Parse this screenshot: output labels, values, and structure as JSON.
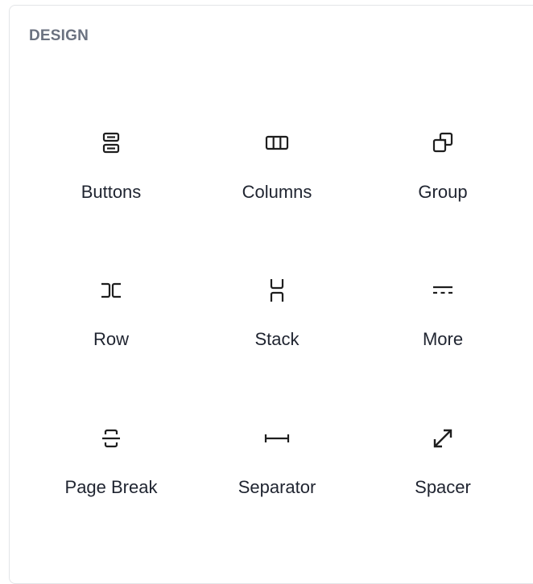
{
  "section": {
    "title": "DESIGN"
  },
  "colors": {
    "icon": "#1e1e1e",
    "label": "#1f2430",
    "section_title": "#6b7280",
    "border": "#e3e5e8"
  },
  "blocks": [
    {
      "label": "Buttons",
      "icon": "buttons-icon"
    },
    {
      "label": "Columns",
      "icon": "columns-icon"
    },
    {
      "label": "Group",
      "icon": "group-icon"
    },
    {
      "label": "Row",
      "icon": "row-icon"
    },
    {
      "label": "Stack",
      "icon": "stack-icon"
    },
    {
      "label": "More",
      "icon": "more-icon"
    },
    {
      "label": "Page Break",
      "icon": "page-break-icon"
    },
    {
      "label": "Separator",
      "icon": "separator-icon"
    },
    {
      "label": "Spacer",
      "icon": "spacer-icon"
    }
  ]
}
